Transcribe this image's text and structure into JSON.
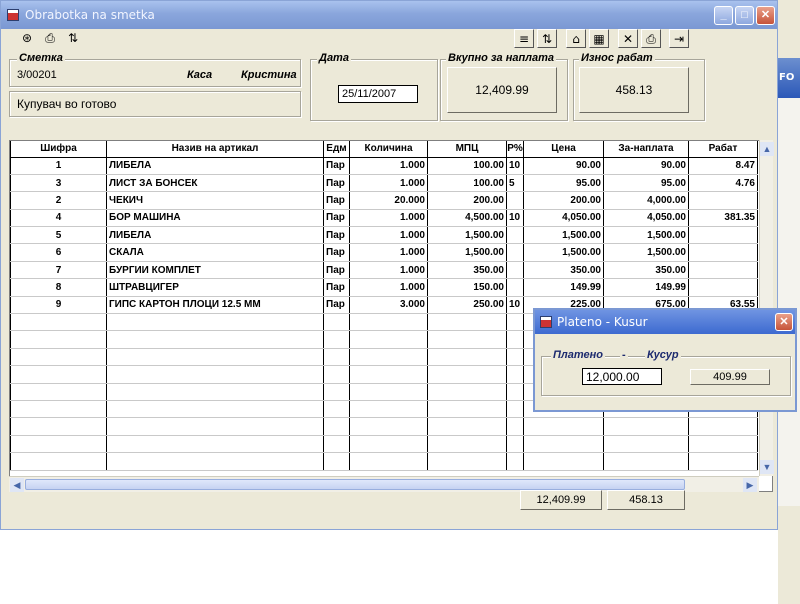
{
  "window": {
    "title": "Obrabotka na smetka",
    "minimize": "_",
    "maximize": "□",
    "close": "✕"
  },
  "desktop": {
    "fragment": "FO"
  },
  "toolbar": {
    "left_icons": [
      "binoculars-icon",
      "print-icon",
      "sort-az-icon"
    ],
    "right_icons": [
      "align-icon",
      "sort-az-icon",
      "open-folder-icon",
      "calculator-icon",
      "delete-icon",
      "print-icon",
      "exit-icon"
    ]
  },
  "bill": {
    "legend": "Сметка",
    "number": "3/00201",
    "cashier_label": "Каса",
    "cashier_name": "Кристина",
    "buyer": "Купувач во готово"
  },
  "date": {
    "legend": "Дата",
    "value": "25/11/2007"
  },
  "total": {
    "legend": "Вкупно за наплата",
    "value": "12,409.99"
  },
  "discount": {
    "legend": "Износ рабат",
    "value": "458.13"
  },
  "table": {
    "columns": [
      "Шифра",
      "Назив на артикал",
      "Едм",
      "Количина",
      "МПЦ",
      "Р%",
      "Цена",
      "За-наплата",
      "Рабат"
    ],
    "rows": [
      [
        "1",
        "ЛИБЕЛА",
        "Пар",
        "1.000",
        "100.00",
        "10",
        "90.00",
        "90.00",
        "8.47"
      ],
      [
        "3",
        "ЛИСТ ЗА БОНСЕК",
        "Пар",
        "1.000",
        "100.00",
        "5",
        "95.00",
        "95.00",
        "4.76"
      ],
      [
        "2",
        "ЧЕКИЧ",
        "Пар",
        "20.000",
        "200.00",
        "",
        "200.00",
        "4,000.00",
        ""
      ],
      [
        "4",
        "БОР МАШИНА",
        "Пар",
        "1.000",
        "4,500.00",
        "10",
        "4,050.00",
        "4,050.00",
        "381.35"
      ],
      [
        "5",
        "ЛИБЕЛА",
        "Пар",
        "1.000",
        "1,500.00",
        "",
        "1,500.00",
        "1,500.00",
        ""
      ],
      [
        "6",
        "СКАЛА",
        "Пар",
        "1.000",
        "1,500.00",
        "",
        "1,500.00",
        "1,500.00",
        ""
      ],
      [
        "7",
        "БУРГИИ КОМПЛЕТ",
        "Пар",
        "1.000",
        "350.00",
        "",
        "350.00",
        "350.00",
        ""
      ],
      [
        "8",
        "ШТРАВЦИГЕР",
        "Пар",
        "1.000",
        "150.00",
        "",
        "149.99",
        "149.99",
        ""
      ],
      [
        "9",
        "ГИПС КАРТОН ПЛОЦИ 12.5 ММ",
        "Пар",
        "3.000",
        "250.00",
        "10",
        "225.00",
        "675.00",
        "63.55"
      ]
    ],
    "empty_rows": 9
  },
  "footer_totals": {
    "payable": "12,409.99",
    "discount": "458.13"
  },
  "dialog": {
    "title": "Plateno - Kusur",
    "paid_label": "Платено",
    "dash": "-",
    "change_label": "Кусур",
    "paid_value": "12,000.00",
    "change_value": "409.99",
    "close": "✕"
  }
}
